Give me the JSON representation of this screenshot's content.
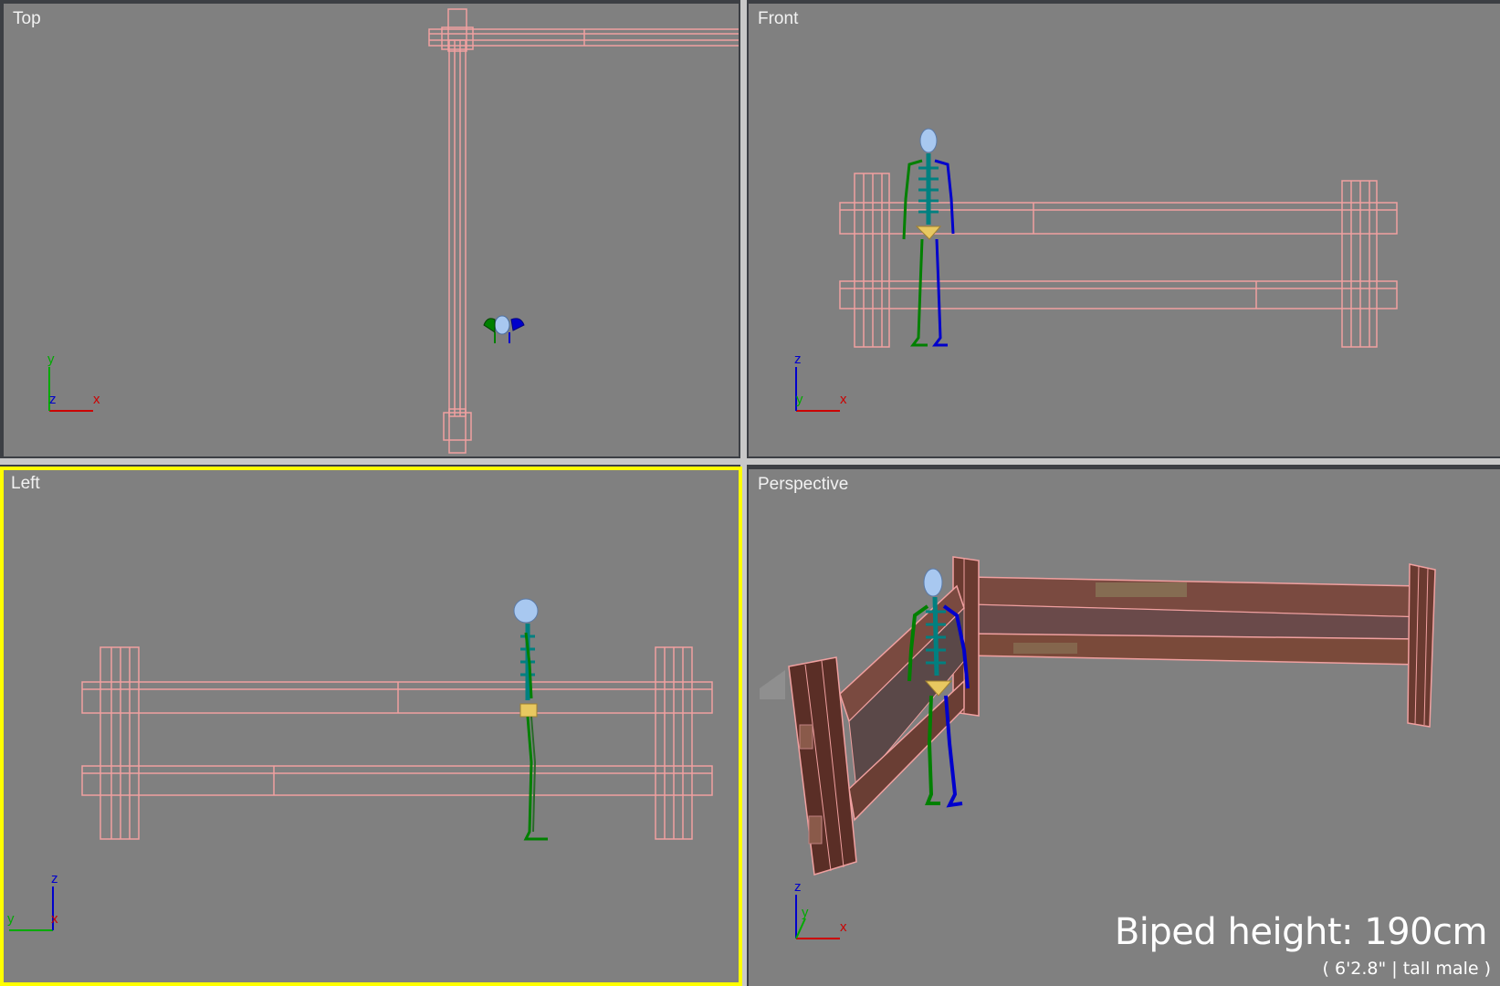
{
  "viewports": {
    "top": {
      "label": "Top",
      "axes": {
        "horizontal": "x",
        "vertical": "y",
        "depth": "z"
      }
    },
    "front": {
      "label": "Front",
      "axes": {
        "horizontal": "x",
        "vertical": "z",
        "depth": "y"
      }
    },
    "left": {
      "label": "Left",
      "axes": {
        "horizontal": "y",
        "vertical": "z",
        "depth": "x"
      },
      "active": true
    },
    "perspective": {
      "label": "Perspective",
      "axes": {
        "horizontal": "x",
        "vertical": "z",
        "depth": "y"
      }
    }
  },
  "biped": {
    "height_text": "Biped height: 190cm",
    "height_sub": "( 6'2.8\" | tall male )"
  },
  "colors": {
    "viewport_bg": "#808080",
    "active_border": "#ffff00",
    "wireframe": "#f0a0a0",
    "axis_x": "#cc0000",
    "axis_y": "#00aa00",
    "axis_z": "#0000cc",
    "bone_head": "#a8c8f0",
    "bone_spine": "#008080",
    "bone_left": "#008000",
    "bone_right": "#0000cc",
    "bone_pelvis": "#e8c860"
  }
}
